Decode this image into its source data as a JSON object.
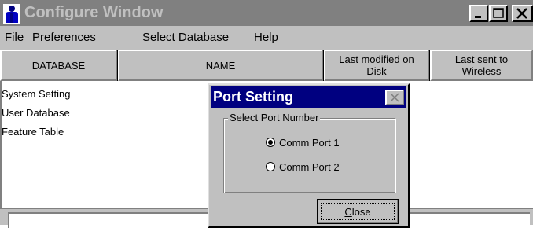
{
  "window": {
    "title": "Configure Window",
    "title_bar_color": "#808080",
    "app_icon": "person-icon",
    "controls": [
      "minimize-icon",
      "maximize-icon",
      "close-icon"
    ]
  },
  "menu": {
    "items": [
      {
        "accel": "F",
        "rest": "ile"
      },
      {
        "accel": "P",
        "rest": "references"
      },
      {
        "accel": "S",
        "rest": "elect Database"
      },
      {
        "accel": "H",
        "rest": "elp"
      }
    ]
  },
  "table": {
    "columns": [
      "DATABASE",
      "NAME",
      "Last modified on Disk",
      "Last sent to Wireless"
    ],
    "rows": [
      "System Setting",
      "User Database",
      "Feature Table"
    ]
  },
  "dialog": {
    "title": "Port Setting",
    "title_bar_color": "#000080",
    "close_icon": "close-icon",
    "group_label": "Select Port Number",
    "options": [
      {
        "label": "Comm Port 1",
        "selected": true
      },
      {
        "label": "Comm Port 2",
        "selected": false
      }
    ],
    "close_button": {
      "accel": "C",
      "rest": "lose"
    }
  }
}
